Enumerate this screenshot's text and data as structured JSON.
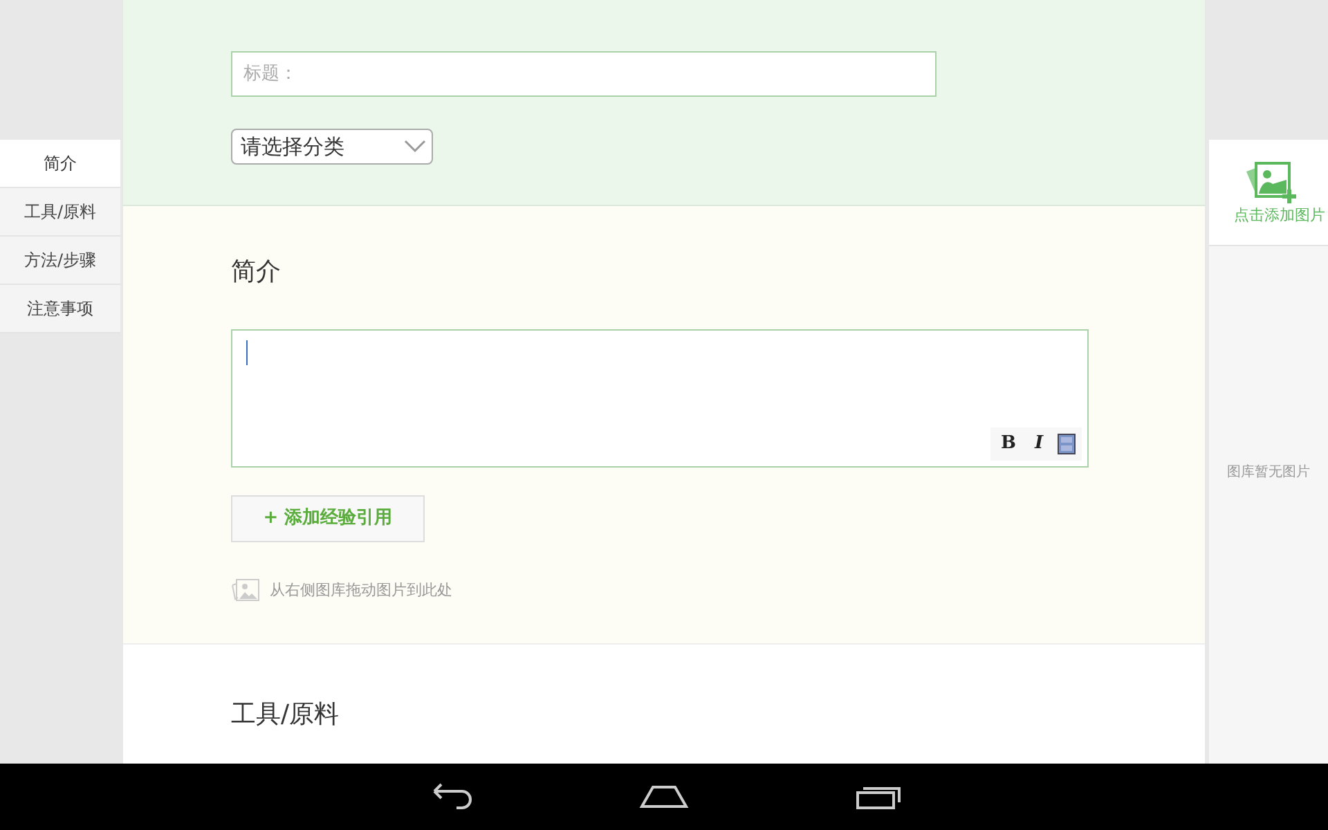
{
  "title_field": {
    "placeholder": "标题："
  },
  "category_select": {
    "value": "请选择分类"
  },
  "nav": [
    {
      "label": "简介",
      "selected": true
    },
    {
      "label": "工具/原料",
      "selected": false
    },
    {
      "label": "方法/步骤",
      "selected": false
    },
    {
      "label": "注意事项",
      "selected": false
    }
  ],
  "intro": {
    "heading": "简介",
    "format_buttons": [
      "B",
      "I"
    ],
    "add_reference": "+ 添加经验引用",
    "drag_hint": "从右侧图库拖动图片到此处"
  },
  "tools_section": {
    "heading": "工具/原料"
  },
  "gallery": {
    "add_label": "点击添加图片",
    "empty_text": "图库暂无图片"
  }
}
